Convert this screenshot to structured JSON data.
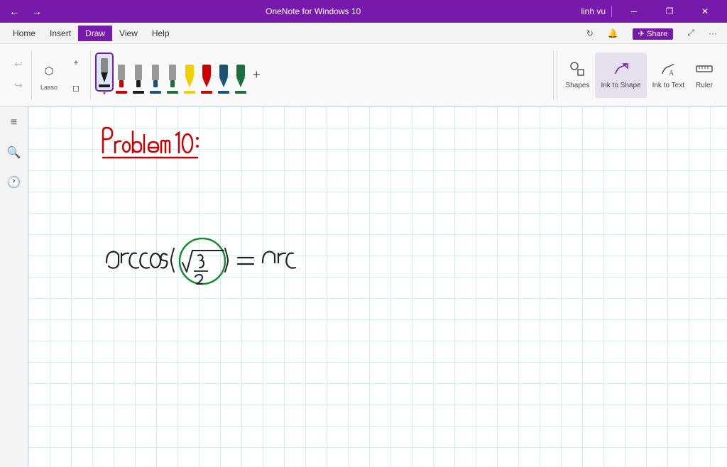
{
  "titlebar": {
    "app_name": "OneNote for Windows 10",
    "user": "linh vu",
    "back_label": "←",
    "forward_label": "→",
    "minimize_label": "─",
    "restore_label": "❐",
    "close_label": "✕"
  },
  "menubar": {
    "items": [
      {
        "id": "home",
        "label": "Home"
      },
      {
        "id": "insert",
        "label": "Insert"
      },
      {
        "id": "draw",
        "label": "Draw"
      },
      {
        "id": "view",
        "label": "View"
      },
      {
        "id": "help",
        "label": "Help"
      }
    ],
    "right_icons": [
      "↻",
      "🔔",
      "Share",
      "⤢",
      "···"
    ]
  },
  "ribbon": {
    "undo_label": "↩",
    "redo_label": "↪",
    "lasso_label": "Lasso",
    "eraser_label": "Erase",
    "add_pen_label": "+",
    "shapes_label": "Shapes",
    "ink_to_shape_label": "Ink to Shape",
    "ink_to_text_label": "Ink to Text",
    "ruler_label": "Ruler",
    "pens": [
      {
        "color": "#1a1a1a",
        "active": true,
        "type": "ballpoint"
      },
      {
        "color": "#cc0000",
        "active": false,
        "type": "felt"
      },
      {
        "color": "#1a1a1a",
        "active": false,
        "type": "felt2"
      },
      {
        "color": "#1a5276",
        "active": false,
        "type": "felt3"
      },
      {
        "color": "#196F3D",
        "active": false,
        "type": "felt4"
      },
      {
        "color": "#f0d000",
        "active": false,
        "type": "highlighter1"
      },
      {
        "color": "#cc0000",
        "active": false,
        "type": "highlighter2"
      },
      {
        "color": "#1a5276",
        "active": false,
        "type": "highlighter3"
      },
      {
        "color": "#196F3D",
        "active": false,
        "type": "highlighter4"
      }
    ]
  },
  "sidebar": {
    "icons": [
      "≡",
      "🔍",
      "🕐"
    ]
  },
  "canvas": {
    "title": "Problem 10 :",
    "equation": "arccos( √3/2 ) = arc"
  }
}
